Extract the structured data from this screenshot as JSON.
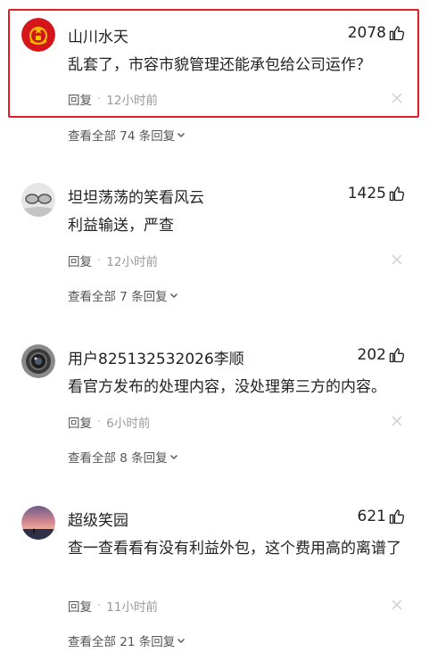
{
  "comments": [
    {
      "user": "山川水天",
      "likes": "2078",
      "text": "乱套了，市容市貌管理还能承包给公司运作？",
      "reply_label": "回复",
      "time": "12小时前",
      "view_replies": "查看全部 74 条回复",
      "avatar_icon": "red-emblem-avatar"
    },
    {
      "user": "坦坦荡荡的笑看风云",
      "likes": "1425",
      "text": "利益输送，严查",
      "reply_label": "回复",
      "time": "12小时前",
      "view_replies": "查看全部 7 条回复",
      "avatar_icon": "glasses-photo-avatar"
    },
    {
      "user": "用户825132532026李顺",
      "likes": "202",
      "text": "看官方发布的处理内容，没处理第三方的内容。",
      "reply_label": "回复",
      "time": "6小时前",
      "view_replies": "查看全部 8 条回复",
      "avatar_icon": "camera-lens-avatar"
    },
    {
      "user": "超级笑园",
      "likes": "621",
      "text": "查一查看看有没有利益外包，这个费用高的离谱了",
      "reply_label": "回复",
      "time": "11小时前",
      "view_replies": "查看全部 21 条回复",
      "avatar_icon": "sunset-photo-avatar"
    }
  ],
  "colors": {
    "highlight": "#e02020",
    "meta": "#999999",
    "text": "#222222"
  }
}
